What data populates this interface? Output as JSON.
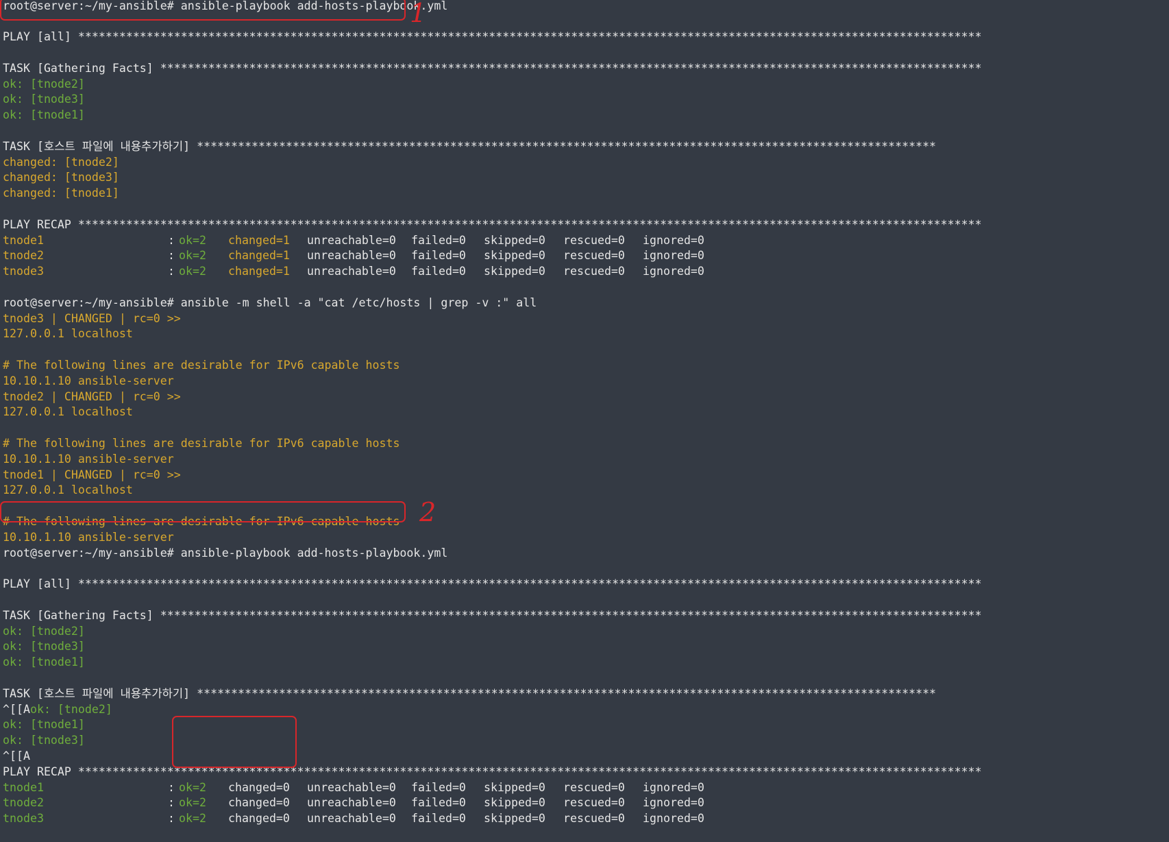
{
  "lines": [
    {
      "type": "text",
      "color": "w",
      "text": "root@server:~/my-ansible# ansible-playbook add-hosts-playbook.yml"
    },
    {
      "type": "blank"
    },
    {
      "type": "text",
      "color": "w",
      "text": "PLAY [all] ************************************************************************************************************************************"
    },
    {
      "type": "blank"
    },
    {
      "type": "text",
      "color": "w",
      "text": "TASK [Gathering Facts] ************************************************************************************************************************"
    },
    {
      "type": "text",
      "color": "g",
      "text": "ok: [tnode2]"
    },
    {
      "type": "text",
      "color": "g",
      "text": "ok: [tnode3]"
    },
    {
      "type": "text",
      "color": "g",
      "text": "ok: [tnode1]"
    },
    {
      "type": "blank"
    },
    {
      "type": "text",
      "color": "w",
      "text": "TASK [호스트 파일에 내용추가하기] ************************************************************************************************************"
    },
    {
      "type": "text",
      "color": "y",
      "text": "changed: [tnode2]"
    },
    {
      "type": "text",
      "color": "y",
      "text": "changed: [tnode3]"
    },
    {
      "type": "text",
      "color": "y",
      "text": "changed: [tnode1]"
    },
    {
      "type": "blank"
    },
    {
      "type": "text",
      "color": "w",
      "text": "PLAY RECAP ************************************************************************************************************************************"
    },
    {
      "type": "recap",
      "host": "tnode1",
      "host_color": "y",
      "colon": ":",
      "ok": "ok=2",
      "changed": "changed=1",
      "changed_color": "y",
      "unreachable": "unreachable=0",
      "failed": "failed=0",
      "skipped": "skipped=0",
      "rescued": "rescued=0",
      "ignored": "ignored=0"
    },
    {
      "type": "recap",
      "host": "tnode2",
      "host_color": "y",
      "colon": ":",
      "ok": "ok=2",
      "changed": "changed=1",
      "changed_color": "y",
      "unreachable": "unreachable=0",
      "failed": "failed=0",
      "skipped": "skipped=0",
      "rescued": "rescued=0",
      "ignored": "ignored=0"
    },
    {
      "type": "recap",
      "host": "tnode3",
      "host_color": "y",
      "colon": ":",
      "ok": "ok=2",
      "changed": "changed=1",
      "changed_color": "y",
      "unreachable": "unreachable=0",
      "failed": "failed=0",
      "skipped": "skipped=0",
      "rescued": "rescued=0",
      "ignored": "ignored=0"
    },
    {
      "type": "blank"
    },
    {
      "type": "text",
      "color": "w",
      "text": "root@server:~/my-ansible# ansible -m shell -a \"cat /etc/hosts | grep -v :\" all"
    },
    {
      "type": "text",
      "color": "y",
      "text": "tnode3 | CHANGED | rc=0 >>"
    },
    {
      "type": "text",
      "color": "y",
      "text": "127.0.0.1 localhost"
    },
    {
      "type": "blank"
    },
    {
      "type": "text",
      "color": "y",
      "text": "# The following lines are desirable for IPv6 capable hosts"
    },
    {
      "type": "text",
      "color": "y",
      "text": "10.10.1.10 ansible-server"
    },
    {
      "type": "text",
      "color": "y",
      "text": "tnode2 | CHANGED | rc=0 >>"
    },
    {
      "type": "text",
      "color": "y",
      "text": "127.0.0.1 localhost"
    },
    {
      "type": "blank"
    },
    {
      "type": "text",
      "color": "y",
      "text": "# The following lines are desirable for IPv6 capable hosts"
    },
    {
      "type": "text",
      "color": "y",
      "text": "10.10.1.10 ansible-server"
    },
    {
      "type": "text",
      "color": "y",
      "text": "tnode1 | CHANGED | rc=0 >>"
    },
    {
      "type": "text",
      "color": "y",
      "text": "127.0.0.1 localhost"
    },
    {
      "type": "blank"
    },
    {
      "type": "text",
      "color": "y",
      "text": "# The following lines are desirable for IPv6 capable hosts"
    },
    {
      "type": "text",
      "color": "y",
      "text": "10.10.1.10 ansible-server"
    },
    {
      "type": "text",
      "color": "w",
      "text": "root@server:~/my-ansible# ansible-playbook add-hosts-playbook.yml"
    },
    {
      "type": "blank"
    },
    {
      "type": "text",
      "color": "w",
      "text": "PLAY [all] ************************************************************************************************************************************"
    },
    {
      "type": "blank"
    },
    {
      "type": "text",
      "color": "w",
      "text": "TASK [Gathering Facts] ************************************************************************************************************************"
    },
    {
      "type": "text",
      "color": "g",
      "text": "ok: [tnode2]"
    },
    {
      "type": "text",
      "color": "g",
      "text": "ok: [tnode3]"
    },
    {
      "type": "text",
      "color": "g",
      "text": "ok: [tnode1]"
    },
    {
      "type": "blank"
    },
    {
      "type": "text",
      "color": "w",
      "text": "TASK [호스트 파일에 내용추가하기] ************************************************************************************************************"
    },
    {
      "type": "split",
      "parts": [
        {
          "color": "w",
          "text": "^[[A"
        },
        {
          "color": "g",
          "text": "ok: [tnode2]"
        }
      ]
    },
    {
      "type": "text",
      "color": "g",
      "text": "ok: [tnode1]"
    },
    {
      "type": "text",
      "color": "g",
      "text": "ok: [tnode3]"
    },
    {
      "type": "text",
      "color": "w",
      "text": "^[[A"
    },
    {
      "type": "text",
      "color": "w",
      "text": "PLAY RECAP ************************************************************************************************************************************"
    },
    {
      "type": "recap",
      "host": "tnode1",
      "host_color": "g",
      "colon": ":",
      "ok": "ok=2",
      "changed": "changed=0",
      "changed_color": "w",
      "unreachable": "unreachable=0",
      "failed": "failed=0",
      "skipped": "skipped=0",
      "rescued": "rescued=0",
      "ignored": "ignored=0"
    },
    {
      "type": "recap",
      "host": "tnode2",
      "host_color": "g",
      "colon": ":",
      "ok": "ok=2",
      "changed": "changed=0",
      "changed_color": "w",
      "unreachable": "unreachable=0",
      "failed": "failed=0",
      "skipped": "skipped=0",
      "rescued": "rescued=0",
      "ignored": "ignored=0"
    },
    {
      "type": "recap",
      "host": "tnode3",
      "host_color": "g",
      "colon": ":",
      "ok": "ok=2",
      "changed": "changed=0",
      "changed_color": "w",
      "unreachable": "unreachable=0",
      "failed": "failed=0",
      "skipped": "skipped=0",
      "rescued": "rescued=0",
      "ignored": "ignored=0"
    }
  ],
  "annotations": [
    {
      "label": "1"
    },
    {
      "label": "2"
    }
  ],
  "colors": {
    "background": "#343a44",
    "default": "#e6e6e6",
    "ok": "#6fae3c",
    "changed": "#d8a82e",
    "annotation": "#d8262a"
  }
}
